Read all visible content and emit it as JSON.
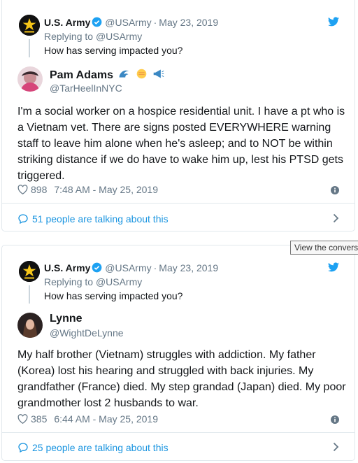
{
  "tweets": [
    {
      "parent": {
        "name": "U.S. Army",
        "handle": "@USArmy",
        "separator": "·",
        "date": "May 23, 2019",
        "replying_prefix": "Replying to ",
        "replying_handle": "@USArmy",
        "text": "How has serving impacted you?"
      },
      "reply": {
        "name": "Pam Adams",
        "name_emojis": [
          "wave-emoji",
          "fist-emoji",
          "megaphone-emoji"
        ],
        "handle": "@TarHeelInNYC",
        "text": "I'm a social worker on a hospice residential unit. I have a pt who is a Vietnam vet. There are signs posted EVERYWHERE warning staff to leave him alone when he's asleep; and to NOT be within striking distance if we do have to wake him up, lest his PTSD gets triggered.",
        "likes": "898",
        "time": "7:48 AM - May 25, 2019"
      },
      "talking": "51 people are talking about this"
    },
    {
      "parent": {
        "name": "U.S. Army",
        "handle": "@USArmy",
        "separator": "·",
        "date": "May 23, 2019",
        "replying_prefix": "Replying to ",
        "replying_handle": "@USArmy",
        "text": "How has serving impacted you?"
      },
      "reply": {
        "name": "Lynne",
        "handle": "@WightDeLynne",
        "text": "My half brother (Vietnam) struggles with addiction. My father (Korea) lost his hearing and struggled with back injuries. My grandfather (France) died. My step grandad (Japan) died. My poor grandmother lost 2 husbands to war.",
        "likes": "385",
        "time": "6:44 AM - May 25, 2019"
      },
      "talking": "25 people are talking about this"
    }
  ],
  "tooltip": "View the conversation",
  "colors": {
    "twitter_blue": "#1b95e0",
    "secondary_text": "#657786",
    "border": "#e1e8ed",
    "verified_blue": "#1da1f2"
  },
  "icons": [
    "army-star-logo-icon",
    "verified-badge-icon",
    "twitter-bird-icon",
    "heart-icon",
    "info-icon",
    "speech-bubble-icon",
    "chevron-right-icon"
  ]
}
